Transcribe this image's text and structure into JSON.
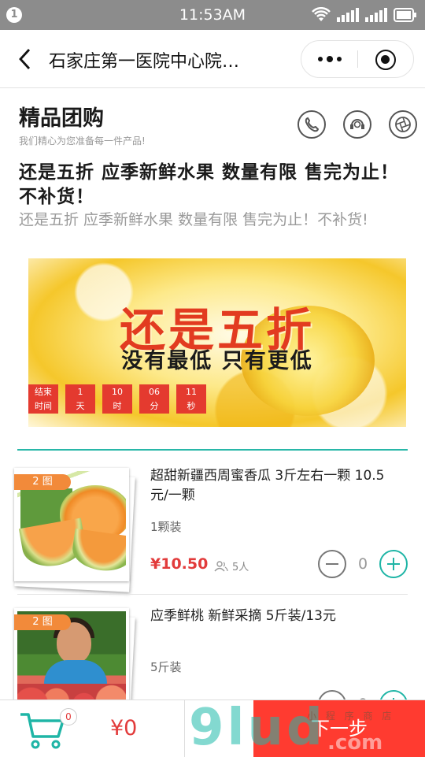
{
  "status": {
    "notification_count": "1",
    "time": "11:53AM"
  },
  "navbar": {
    "title": "石家庄第一医院中心院…"
  },
  "section": {
    "title": "精品团购",
    "subtitle": "我们精心为您准备每一件产品!"
  },
  "promo": {
    "headline": "还是五折 应季新鲜水果 数量有限 售完为止！不补货！",
    "subline": "还是五折 应季新鲜水果 数量有限 售完为止！不补货!",
    "banner_big": "还是五折",
    "banner_slogan": "没有最低 只有更低",
    "countdown": [
      {
        "top": "结束",
        "bottom": "时间"
      },
      {
        "top": "1",
        "bottom": "天"
      },
      {
        "top": "10",
        "bottom": "时"
      },
      {
        "top": "06",
        "bottom": "分"
      },
      {
        "top": "11",
        "bottom": "秒"
      }
    ]
  },
  "products": [
    {
      "image_count": "2 图",
      "name": "超甜新疆西周蜜香瓜 3斤左右一颗 10.5元/一颗",
      "spec": "1颗装",
      "price": "¥10.50",
      "buyers": "5人",
      "quantity": "0"
    },
    {
      "image_count": "2 图",
      "name": "应季鲜桃 新鲜采摘 5斤装/13元",
      "spec": "5斤装",
      "quantity": "0"
    }
  ],
  "footer": {
    "cart_count": "0",
    "total": "¥0",
    "next_label": "下一步"
  },
  "watermark": {
    "main": "9lud",
    "sub": ".com",
    "small": "小 程 序 商 店"
  },
  "colors": {
    "accent": "#1fb5a6",
    "price": "#e23b3b",
    "next_button": "#ff3b30",
    "countdown": "#e43a2f",
    "image_count_tag": "#f28a3a"
  }
}
